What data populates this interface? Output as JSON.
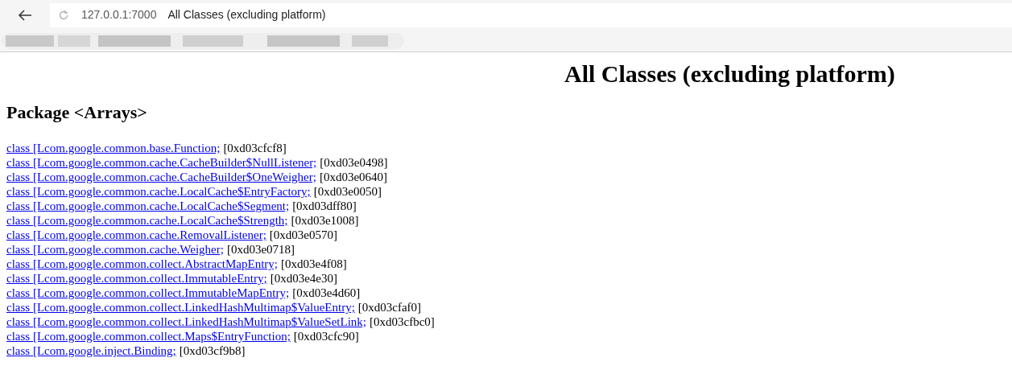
{
  "browser": {
    "url": "127.0.0.1:7000",
    "tab_title": "All Classes (excluding platform)"
  },
  "page": {
    "title": "All Classes (excluding platform)",
    "package_heading": "Package <Arrays>",
    "classes": [
      {
        "name": "class [Lcom.google.common.base.Function;",
        "address": "[0xd03cfcf8]"
      },
      {
        "name": "class [Lcom.google.common.cache.CacheBuilder$NullListener;",
        "address": "[0xd03e0498]"
      },
      {
        "name": "class [Lcom.google.common.cache.CacheBuilder$OneWeigher;",
        "address": "[0xd03e0640]"
      },
      {
        "name": "class [Lcom.google.common.cache.LocalCache$EntryFactory;",
        "address": "[0xd03e0050]"
      },
      {
        "name": "class [Lcom.google.common.cache.LocalCache$Segment;",
        "address": "[0xd03dff80]"
      },
      {
        "name": "class [Lcom.google.common.cache.LocalCache$Strength;",
        "address": "[0xd03e1008]"
      },
      {
        "name": "class [Lcom.google.common.cache.RemovalListener;",
        "address": "[0xd03e0570]"
      },
      {
        "name": "class [Lcom.google.common.cache.Weigher;",
        "address": "[0xd03e0718]"
      },
      {
        "name": "class [Lcom.google.common.collect.AbstractMapEntry;",
        "address": "[0xd03e4f08]"
      },
      {
        "name": "class [Lcom.google.common.collect.ImmutableEntry;",
        "address": "[0xd03e4e30]"
      },
      {
        "name": "class [Lcom.google.common.collect.ImmutableMapEntry;",
        "address": "[0xd03e4d60]"
      },
      {
        "name": "class [Lcom.google.common.collect.LinkedHashMultimap$ValueEntry;",
        "address": "[0xd03cfaf0]"
      },
      {
        "name": "class [Lcom.google.common.collect.LinkedHashMultimap$ValueSetLink;",
        "address": "[0xd03cfbc0]"
      },
      {
        "name": "class [Lcom.google.common.collect.Maps$EntryFunction;",
        "address": "[0xd03cfc90]"
      },
      {
        "name": "class [Lcom.google.inject.Binding;",
        "address": "[0xd03cf9b8]"
      }
    ]
  }
}
